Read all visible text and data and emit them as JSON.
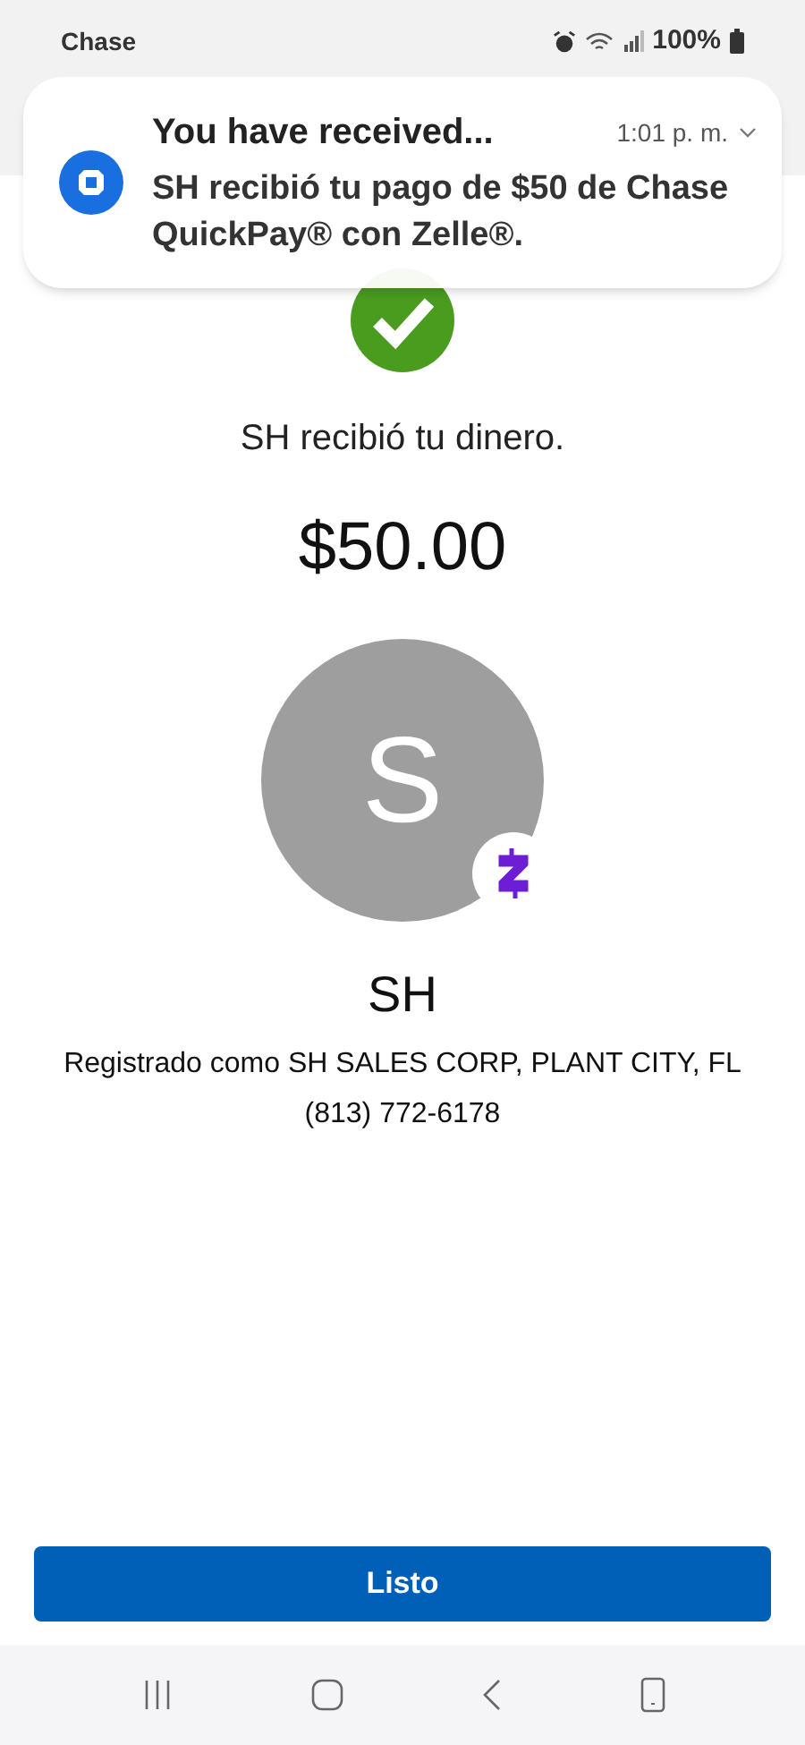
{
  "status_bar": {
    "carrier": "Chase",
    "battery": "100%"
  },
  "notification": {
    "title": "You have received...",
    "time": "1:01 p. m.",
    "body": "SH recibió tu pago de $50 de Chase QuickPay® con Zelle®."
  },
  "confirmation": {
    "message": "SH recibió tu dinero.",
    "amount": "$50.00",
    "avatar_initial": "S",
    "recipient": "SH",
    "registered": "Registrado como SH SALES CORP, PLANT CITY, FL",
    "phone": "(813) 772-6178"
  },
  "button": "Listo"
}
